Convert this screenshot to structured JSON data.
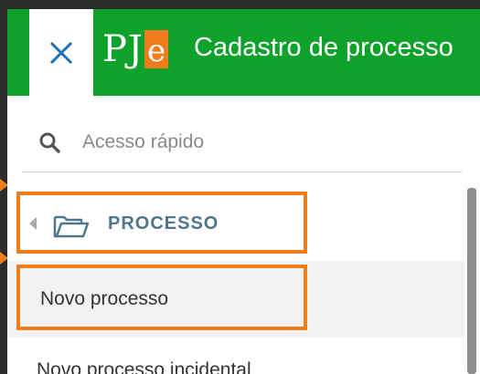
{
  "header": {
    "logo_text": "PJ",
    "logo_letter": "e",
    "title": "Cadastro de processo"
  },
  "search": {
    "placeholder": "Acesso rápido",
    "value": ""
  },
  "menu": {
    "section_label": "PROCESSO",
    "items": [
      {
        "label": "Novo processo"
      },
      {
        "label": "Novo processo incidental"
      }
    ]
  },
  "icons": {
    "close": "close-icon",
    "search": "search-icon",
    "folder": "folder-open-icon",
    "caret": "caret-left-icon"
  },
  "colors": {
    "header_green": "#0ea22a",
    "highlight_orange": "#f07d1c",
    "section_text": "#4f7689"
  }
}
